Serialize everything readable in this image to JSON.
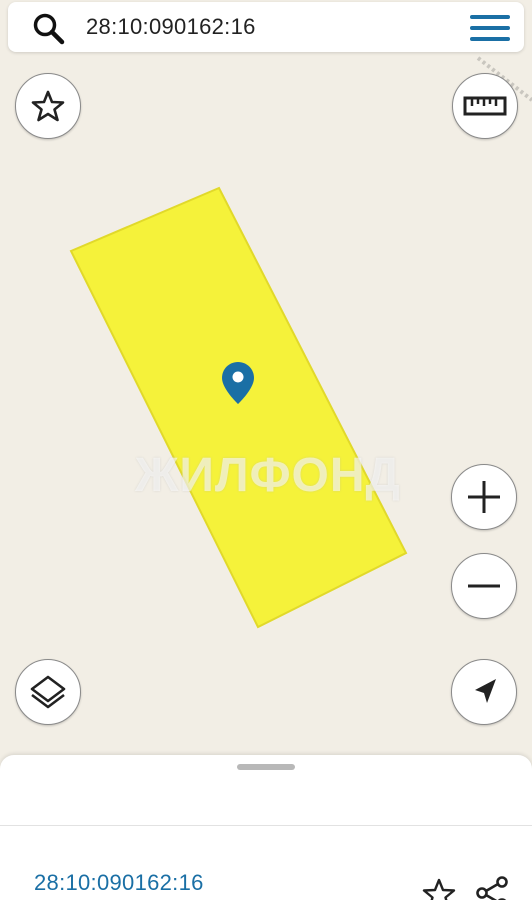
{
  "search": {
    "query": "28:10:090162:16"
  },
  "map": {
    "watermark": "ЖИЛФОНД",
    "parcel_color": "#f5f23a",
    "marker_color": "#1a6fa5",
    "icons": {
      "favorite": "star-icon",
      "ruler": "ruler-icon",
      "zoom_in": "plus-icon",
      "zoom_out": "minus-icon",
      "layers": "layers-icon",
      "locate": "navigation-arrow-icon",
      "marker": "map-pin-icon"
    }
  },
  "sheet": {
    "parcel_number": "28:10:090162:16",
    "icons": {
      "favorite": "star-icon",
      "share": "share-icon"
    }
  },
  "colors": {
    "accent": "#1a6fa5",
    "map_background": "#f2eee5"
  }
}
